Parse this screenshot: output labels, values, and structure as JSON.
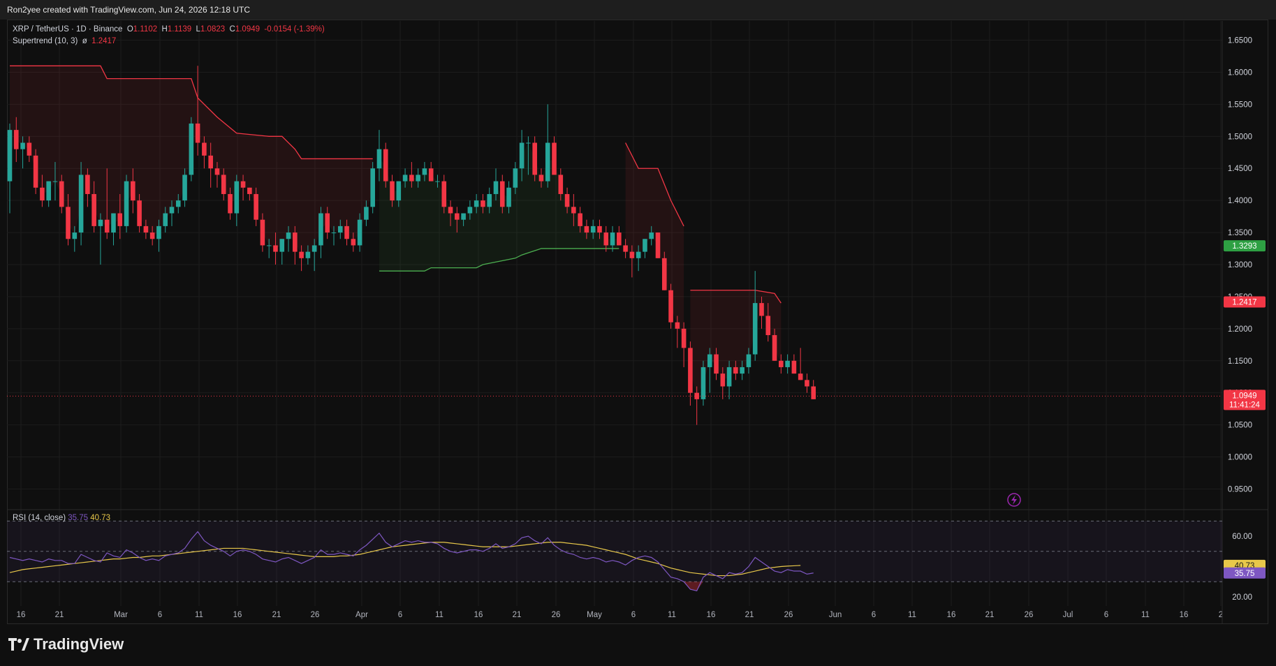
{
  "header": {
    "attribution": "Ron2yee created with TradingView.com, Jun 24, 2026 12:18 UTC"
  },
  "legend": {
    "symbol": "XRP / TetherUS · 1D · Binance",
    "o_label": "O",
    "o": "1.1102",
    "h_label": "H",
    "h": "1.1139",
    "l_label": "L",
    "l": "1.0823",
    "c_label": "C",
    "c": "1.0949",
    "change": "-0.0154 (-1.39%)",
    "supertrend_label": "Supertrend (10, 3)",
    "supertrend_sep": "ø",
    "supertrend_value": "1.2417"
  },
  "rsi_legend": {
    "label": "RSI (14, close)",
    "rsi": "35.75",
    "ma": "40.73"
  },
  "footer": {
    "brand": "TradingView"
  },
  "colors": {
    "up": "#26a69a",
    "down": "#f23645",
    "supertrend_up": "#4caf50",
    "supertrend_down": "#f23645",
    "rsi": "#7e57c2",
    "rsi_ma": "#e8c84a"
  },
  "price_badges": {
    "last_price": "1.0949",
    "countdown": "11:41:24",
    "supertrend_up": "1.3293",
    "supertrend_down": "1.2417",
    "rsi_ma": "40.73",
    "rsi": "35.75"
  },
  "chart_data": {
    "type": "candlestick",
    "x_axis_labels": [
      "16",
      "21",
      "Mar",
      "6",
      "11",
      "16",
      "21",
      "26",
      "Apr",
      "6",
      "11",
      "16",
      "21",
      "26",
      "May",
      "6",
      "11",
      "16",
      "21",
      "26",
      "Jun",
      "6",
      "11",
      "16",
      "21",
      "26",
      "Jul",
      "6",
      "11",
      "16",
      "2"
    ],
    "price_axis_labels": [
      "1.6500",
      "1.6000",
      "1.5500",
      "1.5000",
      "1.4500",
      "1.4000",
      "1.3500",
      "1.3000",
      "1.2500",
      "1.2000",
      "1.1500",
      "1.1000",
      "1.0500",
      "1.0000",
      "0.9500"
    ],
    "rsi_axis_labels": [
      "60.00",
      "20.00"
    ],
    "price_ylim": [
      0.92,
      1.68
    ],
    "rsi_ylim": [
      14,
      72
    ],
    "rsi_bands": [
      70,
      50,
      30
    ],
    "candles": [
      [
        1.43,
        1.52,
        1.38,
        1.51
      ],
      [
        1.51,
        1.53,
        1.46,
        1.48
      ],
      [
        1.48,
        1.5,
        1.45,
        1.49
      ],
      [
        1.49,
        1.5,
        1.46,
        1.47
      ],
      [
        1.47,
        1.48,
        1.41,
        1.42
      ],
      [
        1.42,
        1.44,
        1.39,
        1.4
      ],
      [
        1.4,
        1.43,
        1.39,
        1.43
      ],
      [
        1.43,
        1.46,
        1.4,
        1.43
      ],
      [
        1.43,
        1.44,
        1.38,
        1.39
      ],
      [
        1.39,
        1.41,
        1.33,
        1.34
      ],
      [
        1.34,
        1.36,
        1.32,
        1.35
      ],
      [
        1.35,
        1.46,
        1.33,
        1.44
      ],
      [
        1.44,
        1.45,
        1.39,
        1.41
      ],
      [
        1.41,
        1.43,
        1.35,
        1.36
      ],
      [
        1.36,
        1.38,
        1.3,
        1.37
      ],
      [
        1.37,
        1.45,
        1.34,
        1.35
      ],
      [
        1.35,
        1.38,
        1.33,
        1.38
      ],
      [
        1.38,
        1.41,
        1.34,
        1.36
      ],
      [
        1.36,
        1.44,
        1.35,
        1.43
      ],
      [
        1.43,
        1.45,
        1.38,
        1.4
      ],
      [
        1.4,
        1.41,
        1.35,
        1.36
      ],
      [
        1.36,
        1.37,
        1.34,
        1.35
      ],
      [
        1.35,
        1.36,
        1.33,
        1.34
      ],
      [
        1.34,
        1.37,
        1.32,
        1.36
      ],
      [
        1.36,
        1.39,
        1.35,
        1.38
      ],
      [
        1.38,
        1.4,
        1.36,
        1.39
      ],
      [
        1.39,
        1.41,
        1.38,
        1.4
      ],
      [
        1.4,
        1.45,
        1.39,
        1.44
      ],
      [
        1.44,
        1.53,
        1.43,
        1.52
      ],
      [
        1.52,
        1.61,
        1.47,
        1.49
      ],
      [
        1.49,
        1.5,
        1.45,
        1.47
      ],
      [
        1.47,
        1.49,
        1.42,
        1.45
      ],
      [
        1.45,
        1.46,
        1.42,
        1.44
      ],
      [
        1.44,
        1.45,
        1.4,
        1.41
      ],
      [
        1.41,
        1.42,
        1.37,
        1.38
      ],
      [
        1.38,
        1.44,
        1.36,
        1.43
      ],
      [
        1.43,
        1.44,
        1.4,
        1.42
      ],
      [
        1.42,
        1.42,
        1.4,
        1.41
      ],
      [
        1.41,
        1.42,
        1.36,
        1.37
      ],
      [
        1.37,
        1.38,
        1.32,
        1.33
      ],
      [
        1.33,
        1.34,
        1.31,
        1.33
      ],
      [
        1.33,
        1.35,
        1.3,
        1.32
      ],
      [
        1.32,
        1.34,
        1.3,
        1.34
      ],
      [
        1.34,
        1.36,
        1.32,
        1.35
      ],
      [
        1.35,
        1.36,
        1.3,
        1.32
      ],
      [
        1.32,
        1.33,
        1.29,
        1.31
      ],
      [
        1.31,
        1.33,
        1.3,
        1.32
      ],
      [
        1.32,
        1.34,
        1.29,
        1.33
      ],
      [
        1.33,
        1.39,
        1.31,
        1.38
      ],
      [
        1.38,
        1.39,
        1.34,
        1.35
      ],
      [
        1.35,
        1.36,
        1.33,
        1.35
      ],
      [
        1.35,
        1.37,
        1.34,
        1.36
      ],
      [
        1.36,
        1.37,
        1.33,
        1.34
      ],
      [
        1.34,
        1.35,
        1.32,
        1.33
      ],
      [
        1.33,
        1.38,
        1.32,
        1.37
      ],
      [
        1.37,
        1.4,
        1.36,
        1.39
      ],
      [
        1.39,
        1.46,
        1.38,
        1.45
      ],
      [
        1.45,
        1.51,
        1.43,
        1.48
      ],
      [
        1.48,
        1.49,
        1.42,
        1.43
      ],
      [
        1.43,
        1.44,
        1.39,
        1.4
      ],
      [
        1.4,
        1.43,
        1.39,
        1.43
      ],
      [
        1.43,
        1.45,
        1.42,
        1.44
      ],
      [
        1.44,
        1.46,
        1.42,
        1.43
      ],
      [
        1.43,
        1.45,
        1.42,
        1.44
      ],
      [
        1.44,
        1.46,
        1.43,
        1.45
      ],
      [
        1.45,
        1.46,
        1.43,
        1.43
      ],
      [
        1.43,
        1.44,
        1.42,
        1.43
      ],
      [
        1.43,
        1.44,
        1.38,
        1.39
      ],
      [
        1.39,
        1.4,
        1.36,
        1.38
      ],
      [
        1.38,
        1.39,
        1.35,
        1.37
      ],
      [
        1.37,
        1.38,
        1.36,
        1.38
      ],
      [
        1.38,
        1.4,
        1.37,
        1.39
      ],
      [
        1.39,
        1.41,
        1.38,
        1.4
      ],
      [
        1.4,
        1.41,
        1.38,
        1.39
      ],
      [
        1.39,
        1.42,
        1.38,
        1.41
      ],
      [
        1.41,
        1.45,
        1.4,
        1.43
      ],
      [
        1.43,
        1.44,
        1.38,
        1.39
      ],
      [
        1.39,
        1.43,
        1.38,
        1.42
      ],
      [
        1.42,
        1.46,
        1.41,
        1.45
      ],
      [
        1.45,
        1.51,
        1.43,
        1.49
      ],
      [
        1.49,
        1.5,
        1.44,
        1.49
      ],
      [
        1.49,
        1.5,
        1.43,
        1.44
      ],
      [
        1.44,
        1.45,
        1.42,
        1.43
      ],
      [
        1.43,
        1.55,
        1.42,
        1.49
      ],
      [
        1.49,
        1.5,
        1.44,
        1.44
      ],
      [
        1.44,
        1.45,
        1.4,
        1.41
      ],
      [
        1.41,
        1.42,
        1.38,
        1.39
      ],
      [
        1.39,
        1.41,
        1.36,
        1.38
      ],
      [
        1.38,
        1.39,
        1.35,
        1.36
      ],
      [
        1.36,
        1.37,
        1.34,
        1.35
      ],
      [
        1.35,
        1.37,
        1.34,
        1.36
      ],
      [
        1.36,
        1.37,
        1.34,
        1.35
      ],
      [
        1.35,
        1.36,
        1.32,
        1.33
      ],
      [
        1.33,
        1.36,
        1.32,
        1.35
      ],
      [
        1.35,
        1.36,
        1.33,
        1.33
      ],
      [
        1.33,
        1.34,
        1.31,
        1.32
      ],
      [
        1.32,
        1.33,
        1.28,
        1.31
      ],
      [
        1.31,
        1.33,
        1.29,
        1.32
      ],
      [
        1.32,
        1.34,
        1.31,
        1.34
      ],
      [
        1.34,
        1.36,
        1.33,
        1.35
      ],
      [
        1.35,
        1.35,
        1.31,
        1.31
      ],
      [
        1.31,
        1.32,
        1.26,
        1.26
      ],
      [
        1.26,
        1.27,
        1.2,
        1.21
      ],
      [
        1.21,
        1.22,
        1.17,
        1.2
      ],
      [
        1.2,
        1.21,
        1.14,
        1.17
      ],
      [
        1.17,
        1.18,
        1.08,
        1.1
      ],
      [
        1.1,
        1.11,
        1.05,
        1.09
      ],
      [
        1.09,
        1.15,
        1.08,
        1.14
      ],
      [
        1.14,
        1.17,
        1.1,
        1.16
      ],
      [
        1.16,
        1.17,
        1.12,
        1.13
      ],
      [
        1.13,
        1.14,
        1.09,
        1.11
      ],
      [
        1.11,
        1.15,
        1.09,
        1.14
      ],
      [
        1.14,
        1.15,
        1.12,
        1.13
      ],
      [
        1.13,
        1.15,
        1.12,
        1.14
      ],
      [
        1.14,
        1.17,
        1.13,
        1.16
      ],
      [
        1.16,
        1.29,
        1.15,
        1.24
      ],
      [
        1.24,
        1.25,
        1.2,
        1.22
      ],
      [
        1.22,
        1.24,
        1.18,
        1.19
      ],
      [
        1.19,
        1.2,
        1.15,
        1.15
      ],
      [
        1.15,
        1.16,
        1.13,
        1.14
      ],
      [
        1.14,
        1.16,
        1.13,
        1.15
      ],
      [
        1.15,
        1.16,
        1.13,
        1.13
      ],
      [
        1.13,
        1.17,
        1.12,
        1.12
      ],
      [
        1.12,
        1.13,
        1.1,
        1.11
      ],
      [
        1.11,
        1.12,
        1.09,
        1.09
      ]
    ],
    "supertrend": [
      [
        0,
        1.61
      ],
      [
        14,
        1.61
      ],
      [
        15,
        1.59
      ],
      [
        28,
        1.59
      ],
      [
        29,
        1.56
      ],
      [
        32,
        1.53
      ],
      [
        35,
        1.505
      ],
      [
        40,
        1.5
      ],
      [
        42,
        1.5
      ],
      [
        44,
        1.48
      ],
      [
        45,
        1.465
      ],
      [
        56,
        1.465
      ],
      [
        57,
        1.29
      ],
      [
        64,
        1.29
      ],
      [
        65,
        1.295
      ],
      [
        72,
        1.295
      ],
      [
        73,
        1.3
      ],
      [
        78,
        1.31
      ],
      [
        79,
        1.315
      ],
      [
        82,
        1.325
      ],
      [
        90,
        1.325
      ],
      [
        94,
        1.325
      ],
      [
        95,
        1.49
      ],
      [
        97,
        1.45
      ],
      [
        100,
        1.45
      ],
      [
        102,
        1.4
      ],
      [
        104,
        1.36
      ],
      [
        105,
        1.26
      ],
      [
        115,
        1.26
      ],
      [
        118,
        1.255
      ],
      [
        119,
        1.24
      ]
    ],
    "rsi": [
      46,
      45,
      44,
      45,
      44,
      43,
      45,
      44,
      44,
      42,
      42,
      48,
      46,
      44,
      43,
      49,
      47,
      46,
      51,
      49,
      46,
      44,
      45,
      44,
      47,
      48,
      49,
      52,
      58,
      63,
      57,
      54,
      52,
      50,
      47,
      50,
      51,
      50,
      48,
      45,
      44,
      43,
      45,
      46,
      44,
      42,
      44,
      46,
      51,
      48,
      48,
      49,
      48,
      47,
      51,
      54,
      58,
      62,
      56,
      53,
      55,
      57,
      56,
      57,
      56,
      56,
      55,
      52,
      50,
      49,
      50,
      51,
      51,
      50,
      52,
      55,
      52,
      53,
      55,
      59,
      60,
      57,
      55,
      59,
      54,
      51,
      49,
      48,
      46,
      45,
      46,
      45,
      43,
      44,
      43,
      41,
      44,
      46,
      47,
      46,
      43,
      38,
      33,
      32,
      30,
      25,
      24,
      33,
      36,
      34,
      32,
      36,
      35,
      36,
      40,
      46,
      43,
      40,
      37,
      36,
      38,
      37,
      37,
      35,
      35.75
    ],
    "rsi_ma": [
      36,
      37,
      38,
      38.5,
      39,
      39.5,
      40,
      40.5,
      41,
      41.5,
      42,
      42.5,
      43,
      43.5,
      44,
      44.5,
      45,
      45,
      45.5,
      46,
      46,
      46.5,
      47,
      47,
      47.5,
      48,
      48.5,
      49,
      49.5,
      50,
      50.5,
      51,
      51.5,
      52,
      52,
      52,
      52,
      51.5,
      51,
      50.5,
      50,
      49.5,
      49,
      48.5,
      48,
      47.5,
      47,
      46.5,
      46.5,
      46.5,
      46.5,
      47,
      47,
      47.5,
      48,
      49,
      50,
      51,
      52,
      53,
      53.5,
      54,
      54.5,
      55,
      55.5,
      56,
      56,
      56,
      55.5,
      55,
      54.5,
      54,
      53.5,
      53,
      53,
      53,
      53,
      53,
      53.5,
      54,
      54.5,
      55,
      55.5,
      56,
      56,
      56,
      55.5,
      55,
      54.5,
      54,
      53,
      52,
      51,
      50,
      49,
      48,
      46.5,
      45,
      44,
      43,
      42,
      40.5,
      39,
      38,
      37,
      36,
      35.5,
      35,
      34.5,
      34,
      34,
      34,
      34.5,
      35,
      36,
      37,
      38,
      39,
      39.5,
      40,
      40.3,
      40.5,
      40.73
    ]
  }
}
